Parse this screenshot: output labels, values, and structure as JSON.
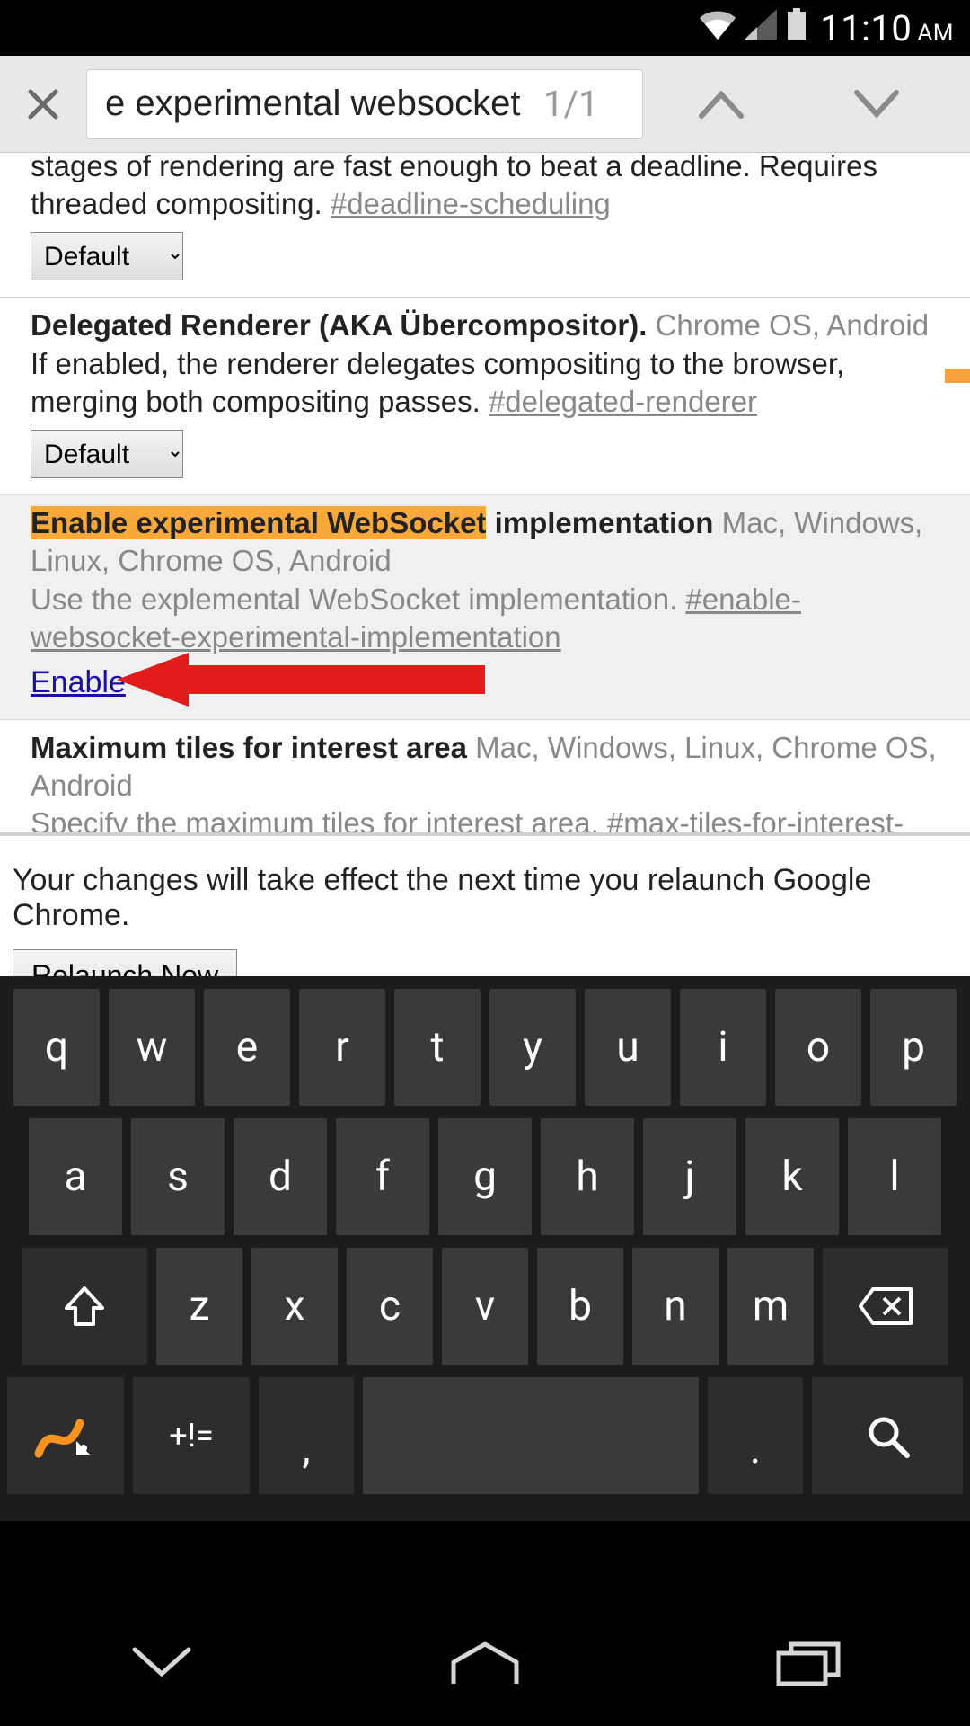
{
  "status": {
    "time": "11:10",
    "ampm": "AM"
  },
  "findbar": {
    "query": "e experimental websocket",
    "count": "1/1"
  },
  "flags": {
    "deadline": {
      "partial_desc": "stages of rendering are fast enough to beat a deadline. Requires threaded compositing. ",
      "anchor": "#deadline-scheduling",
      "select": "Default"
    },
    "delegated": {
      "title": "Delegated Renderer (AKA Übercompositor).",
      "platforms": " Chrome OS, Android",
      "desc": "If enabled, the renderer delegates compositing to the browser, merging both compositing passes. ",
      "anchor": "#delegated-renderer",
      "select": "Default"
    },
    "websocket": {
      "title_hl": "Enable experimental WebSocket",
      "title_rest": " implementation",
      "platforms": " Mac, Windows, Linux, Chrome OS, Android",
      "desc": "Use the explemental WebSocket implementation. ",
      "anchor": "#enable-websocket-experimental-implementation",
      "enable": "Enable"
    },
    "maxtiles": {
      "title": "Maximum tiles for interest area",
      "platforms": " Mac, Windows, Linux, Chrome OS, Android",
      "desc": "Specify the maximum tiles for interest area. ",
      "anchor": "#max-tiles-for-interest-"
    }
  },
  "relaunch": {
    "msg": "Your changes will take effect the next time you relaunch Google Chrome.",
    "btn": "Relaunch Now"
  },
  "keyboard": {
    "r1": [
      "q",
      "w",
      "e",
      "r",
      "t",
      "y",
      "u",
      "i",
      "o",
      "p"
    ],
    "r2": [
      "a",
      "s",
      "d",
      "f",
      "g",
      "h",
      "j",
      "k",
      "l"
    ],
    "r3": [
      "z",
      "x",
      "c",
      "v",
      "b",
      "n",
      "m"
    ],
    "sym": "+!=",
    "comma": ",",
    "period": "."
  }
}
